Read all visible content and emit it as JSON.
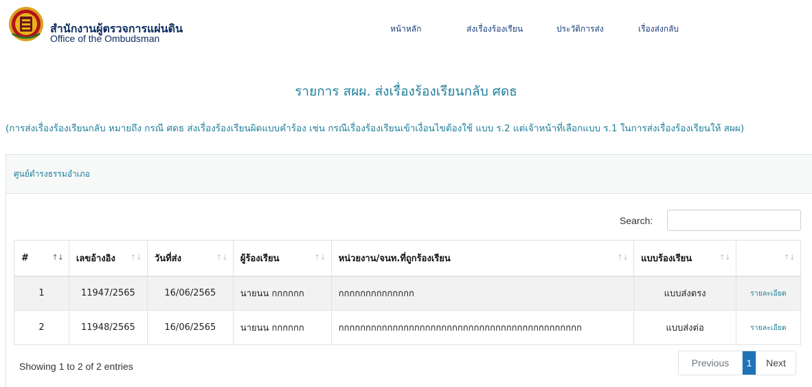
{
  "header": {
    "org_name_th": "สำนักงานผู้ตรวจการแผ่นดิน",
    "org_name_en": "Office of the Ombudsman",
    "nav": [
      {
        "label": "หน้าหลัก"
      },
      {
        "label": "ส่งเรื่องร้องเรียน"
      },
      {
        "label": "ประวัติการส่ง"
      },
      {
        "label": "เรื่องส่งกลับ"
      }
    ]
  },
  "main": {
    "title": "รายการ สผผ. ส่งเรื่องร้องเรียนกลับ ศดธ",
    "note": "(การส่งเรื่องร้องเรียนกลับ หมายถึง กรณี ศดธ ส่งเรื่องร้องเรียนผิดแบบคำร้อง เช่น กรณีเรื่องร้องเรียนเข้าเงื่อนไขต้องใช้ แบบ ร.2 แต่เจ้าหน้าที่เลือกแบบ ร.1 ในการส่งเรื่องร้องเรียนให้ สผผ)",
    "card_title": "ศูนย์ดำรงธรรมอำเภอ",
    "search": {
      "label": "Search:",
      "value": ""
    },
    "table": {
      "headers": [
        "#",
        "เลขอ้างอิง",
        "วันที่ส่ง",
        "ผู้ร้องเรียน",
        "หน่วยงาน/จนท.ที่ถูกร้องเรียน",
        "แบบร้องเรียน",
        ""
      ],
      "rows": [
        {
          "no": "1",
          "ref": "11947/2565",
          "date": "16/06/2565",
          "complainant": "นายนน กกกกกก",
          "agency": "กกกกกกกกกกกกกก",
          "form": "แบบส่งตรง",
          "action": "รายละเอียด"
        },
        {
          "no": "2",
          "ref": "11948/2565",
          "date": "16/06/2565",
          "complainant": "นายนน กกกกกก",
          "agency": "กกกกกกกกกกกกกกกกกกกกกกกกกกกกกกกกกกกกกกกกกกกกก",
          "form": "แบบส่งต่อ",
          "action": "รายละเอียด"
        }
      ]
    },
    "info": "Showing 1 to 2 of 2 entries",
    "pagination": {
      "previous": "Previous",
      "current": "1",
      "next": "Next"
    }
  }
}
